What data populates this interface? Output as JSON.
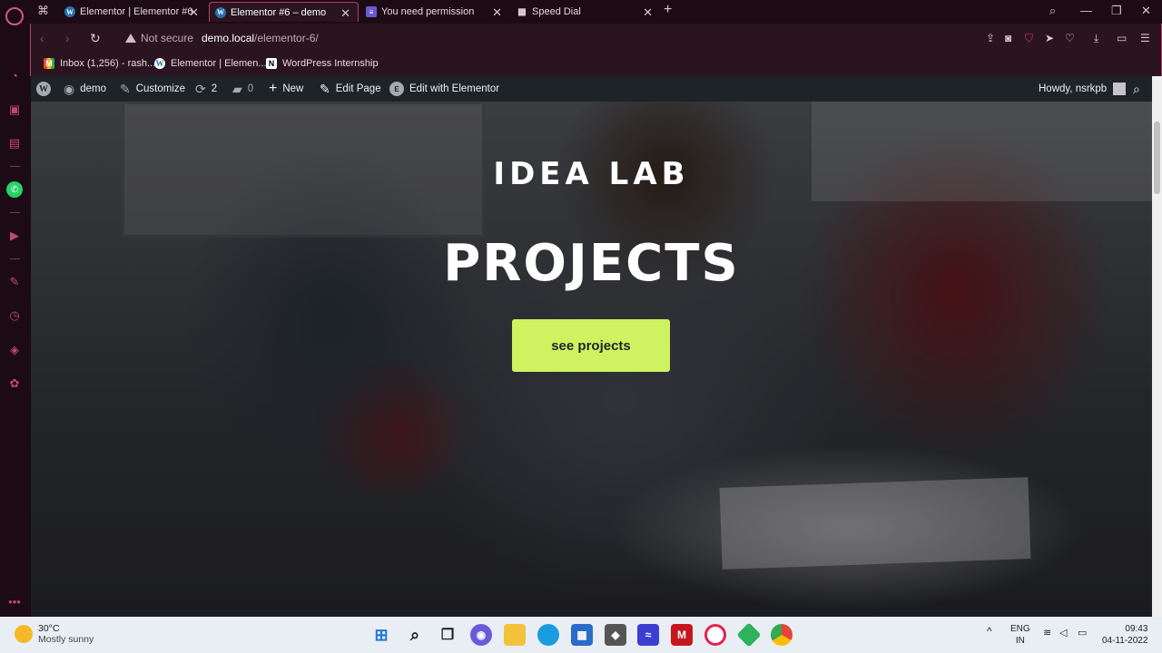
{
  "tabs": [
    {
      "title": "Elementor | Elementor #6",
      "active": false,
      "icon": "wordpress-icon"
    },
    {
      "title": "Elementor #6 – demo",
      "active": true,
      "icon": "wordpress-icon"
    },
    {
      "title": "You need permission",
      "active": false,
      "icon": "forms-icon"
    },
    {
      "title": "Speed Dial",
      "active": false,
      "icon": "speed-dial-icon"
    }
  ],
  "address": {
    "security": "Not secure",
    "host": "demo.local",
    "path": "/elementor-6/"
  },
  "bookmarks": [
    {
      "label": "Inbox (1,256) - rash...",
      "icon": "gmail-icon"
    },
    {
      "label": "Elementor | Elemen...",
      "icon": "wordpress-icon"
    },
    {
      "label": "WordPress Internship",
      "icon": "notion-icon"
    }
  ],
  "wpbar": {
    "site": "demo",
    "customize": "Customize",
    "updates": "2",
    "comments": "0",
    "new": "New",
    "edit_page": "Edit Page",
    "edit_elementor": "Edit with Elementor",
    "howdy": "Howdy, nsrkpb"
  },
  "hero": {
    "subtitle": "IDEA LAB",
    "title": "PROJECTS",
    "button": "see projects",
    "button_color": "#cff260"
  },
  "taskbar": {
    "temp": "30°C",
    "condition": "Mostly sunny",
    "lang_top": "ENG",
    "lang_bottom": "IN",
    "time": "09:43",
    "date": "04-11-2022"
  },
  "colors": {
    "accent": "#c0396b",
    "wp_bar": "#1d2327"
  }
}
